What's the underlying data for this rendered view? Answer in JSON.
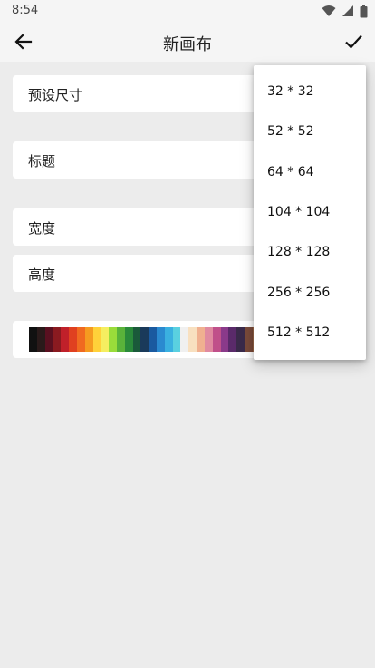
{
  "status_bar": {
    "time": "8:54",
    "icons": [
      "wifi-icon",
      "signal-icon",
      "battery-icon"
    ]
  },
  "app_bar": {
    "title": "新画布",
    "back_icon": "arrow-back-icon",
    "confirm_icon": "check-icon"
  },
  "form": {
    "preset_size_label": "预设尺寸",
    "title_label": "标题",
    "width_label": "宽度",
    "height_label": "高度"
  },
  "palette": {
    "colors": [
      "#111111",
      "#2a1a1a",
      "#5a1020",
      "#8a1a20",
      "#c0202a",
      "#e04020",
      "#f06a20",
      "#f59b20",
      "#ffd23a",
      "#f5ee60",
      "#9adc3a",
      "#5ab33a",
      "#2a8a3a",
      "#1a5a3a",
      "#1a3a5a",
      "#1a5aa0",
      "#2a8ad0",
      "#3ab0e0",
      "#5ad0e0",
      "#f0f0f0",
      "#f8e0c0",
      "#f0b090",
      "#e08aa0",
      "#c0508a",
      "#8a3a8a",
      "#5a2a6a",
      "#3a2a4a",
      "#7a4a3a",
      "#a06a4a",
      "#d09a6a",
      "#e0c09a",
      "#b0b8c8",
      "#8a90a8",
      "#6a6a80",
      "#4a4a5a",
      "#2a2a3a",
      "#5a3a3a",
      "#8a5a5a",
      "#b08a7a",
      "#d0b0a0",
      "#c0c8e0",
      "#a0a8d0"
    ]
  },
  "dropdown": {
    "options": [
      "32 * 32",
      "52 * 52",
      "64 * 64",
      "104 * 104",
      "128 * 128",
      "256 * 256",
      "512 * 512"
    ]
  },
  "colors": {
    "background": "#ececec",
    "bar": "#f5f5f5",
    "card": "#ffffff"
  }
}
